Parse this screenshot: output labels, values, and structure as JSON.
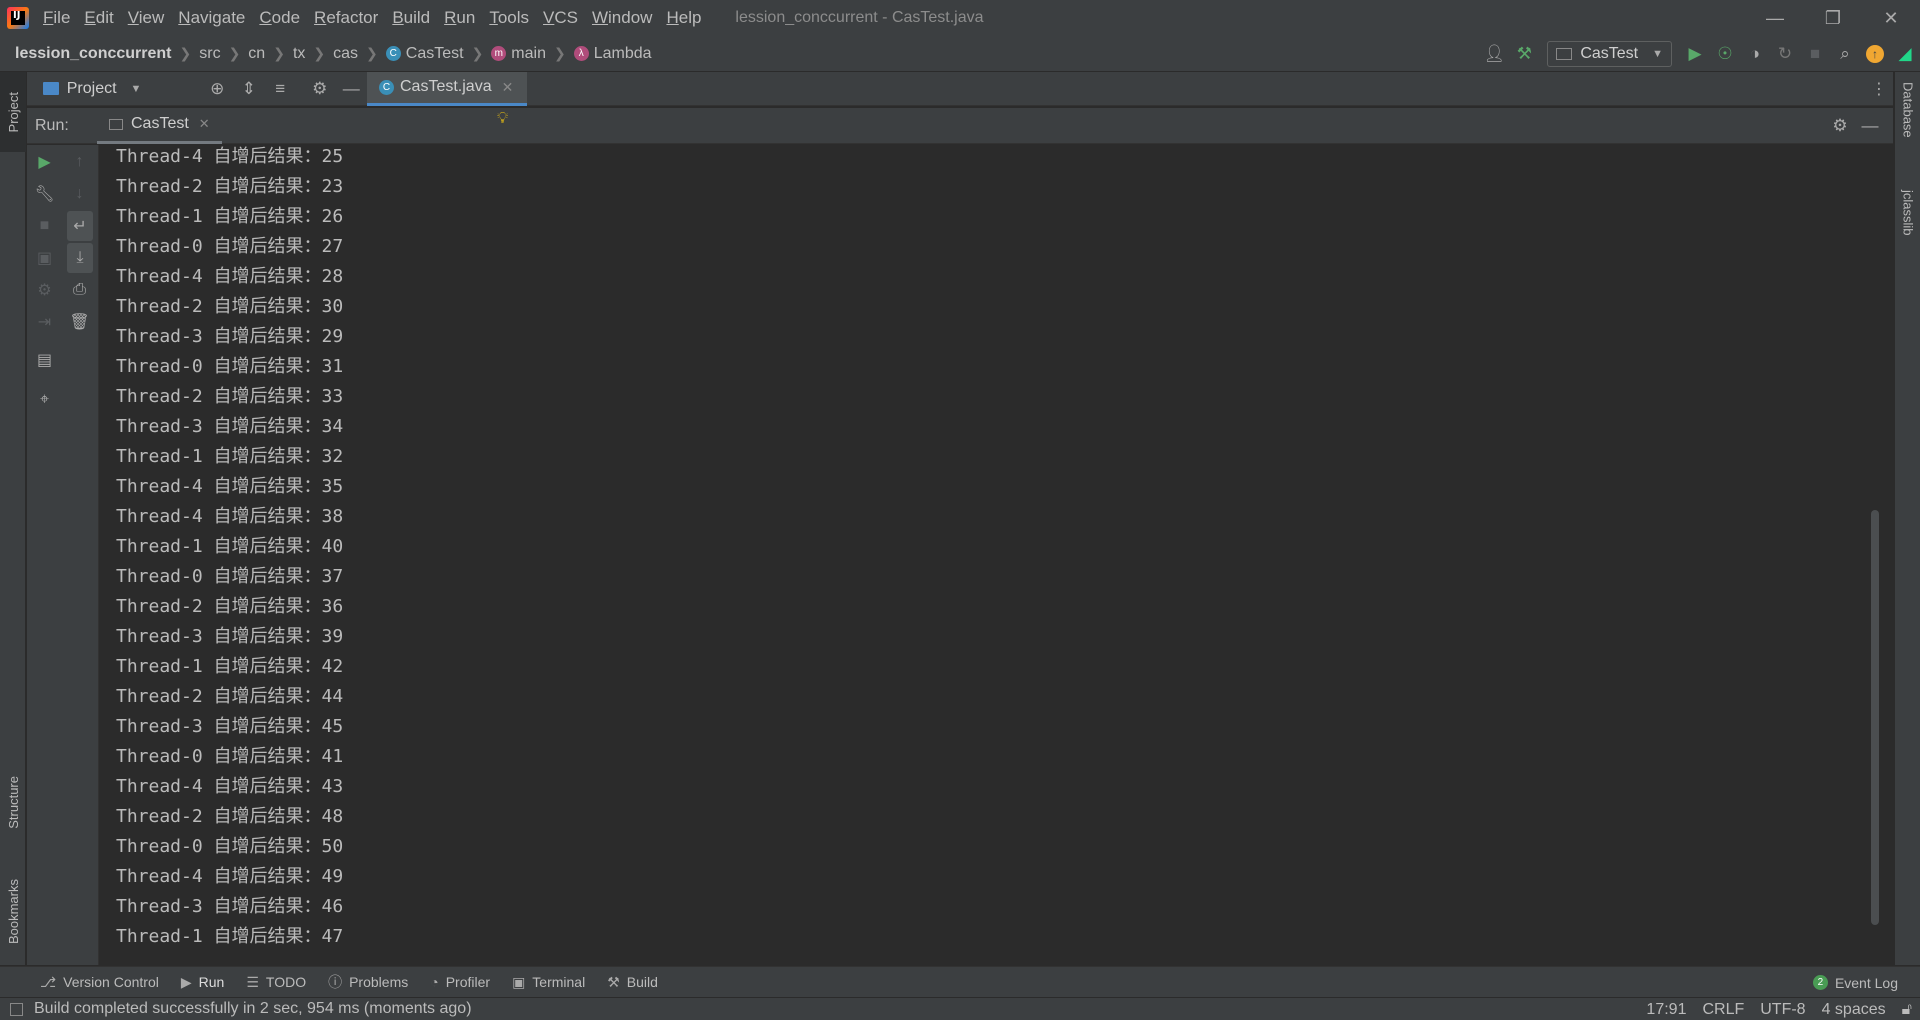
{
  "menu": {
    "items": [
      "File",
      "Edit",
      "View",
      "Navigate",
      "Code",
      "Refactor",
      "Build",
      "Run",
      "Tools",
      "VCS",
      "Window",
      "Help"
    ],
    "window_title": "lession_conccurrent - CasTest.java"
  },
  "breadcrumb": {
    "project": "lession_conccurrent",
    "src": "src",
    "cn": "cn",
    "tx": "tx",
    "cas": "cas",
    "class": "CasTest",
    "method": "main",
    "lambda": "Lambda"
  },
  "toolbar": {
    "run_config": "CasTest"
  },
  "project_panel": {
    "title": "Project"
  },
  "editor": {
    "tab_label": "CasTest.java"
  },
  "run_window": {
    "label": "Run:",
    "tab_label": "CasTest"
  },
  "side_tabs": {
    "project": "Project",
    "structure": "Structure",
    "bookmarks": "Bookmarks",
    "database": "Database",
    "jclasslib": "jclasslib"
  },
  "console": {
    "lines": [
      "Thread-4 自增后结果：25",
      "Thread-2 自增后结果：23",
      "Thread-1 自增后结果：26",
      "Thread-0 自增后结果：27",
      "Thread-4 自增后结果：28",
      "Thread-2 自增后结果：30",
      "Thread-3 自增后结果：29",
      "Thread-0 自增后结果：31",
      "Thread-2 自增后结果：33",
      "Thread-3 自增后结果：34",
      "Thread-1 自增后结果：32",
      "Thread-4 自增后结果：35",
      "Thread-4 自增后结果：38",
      "Thread-1 自增后结果：40",
      "Thread-0 自增后结果：37",
      "Thread-2 自增后结果：36",
      "Thread-3 自增后结果：39",
      "Thread-1 自增后结果：42",
      "Thread-2 自增后结果：44",
      "Thread-3 自增后结果：45",
      "Thread-0 自增后结果：41",
      "Thread-4 自增后结果：43",
      "Thread-2 自增后结果：48",
      "Thread-0 自增后结果：50",
      "Thread-4 自增后结果：49",
      "Thread-3 自增后结果：46",
      "Thread-1 自增后结果：47"
    ]
  },
  "bottom_tabs": {
    "version_control": "Version Control",
    "run": "Run",
    "todo": "TODO",
    "problems": "Problems",
    "profiler": "Profiler",
    "terminal": "Terminal",
    "build": "Build",
    "event_log": "Event Log",
    "event_count": "2"
  },
  "statusbar": {
    "message": "Build completed successfully in 2 sec, 954 ms (moments ago)",
    "position": "17:91",
    "line_sep": "CRLF",
    "encoding": "UTF-8",
    "indent": "4 spaces"
  },
  "colors": {
    "background": "#2b2b2b",
    "panel": "#3c3f41",
    "accent": "#4a88c7",
    "run_green": "#59a869"
  }
}
